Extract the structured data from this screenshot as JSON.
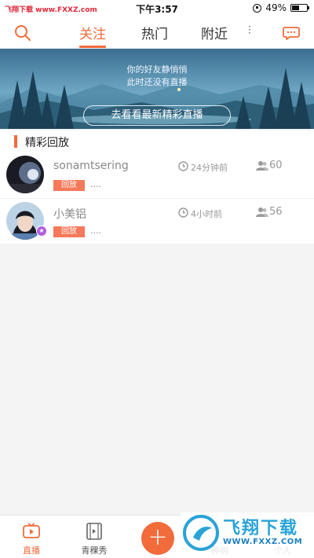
{
  "status_bar": {
    "watermark_left": "飞翔下载",
    "watermark_url": "www.FXXZ.com",
    "time": "下午3:57",
    "battery": "49%"
  },
  "nav": {
    "tabs": [
      {
        "label": "关注",
        "active": true
      },
      {
        "label": "热门",
        "active": false
      },
      {
        "label": "附近",
        "active": false
      }
    ]
  },
  "banner": {
    "line1": "你的好友静悄悄",
    "line2": "此时还没有直播",
    "button": "去看看最新精彩直播"
  },
  "section": {
    "title": "精彩回放"
  },
  "replays": [
    {
      "name": "sonamtsering",
      "tag": "回放",
      "desc": "....",
      "time": "24分钟前",
      "views": "60"
    },
    {
      "name": "小美铝",
      "tag": "回放",
      "desc": "....",
      "time": "4小时前",
      "views": "56"
    }
  ],
  "tabbar": {
    "items": [
      {
        "label": "直播",
        "active": true
      },
      {
        "label": "青稞秀",
        "active": false
      },
      {
        "label": "种树",
        "active": false
      },
      {
        "label": "个人",
        "active": false
      }
    ]
  },
  "watermark": {
    "title": "飞翔下载",
    "url": "WWW.FXXZ.COM"
  },
  "colors": {
    "accent": "#f26b3a",
    "tag": "#f5795a"
  }
}
